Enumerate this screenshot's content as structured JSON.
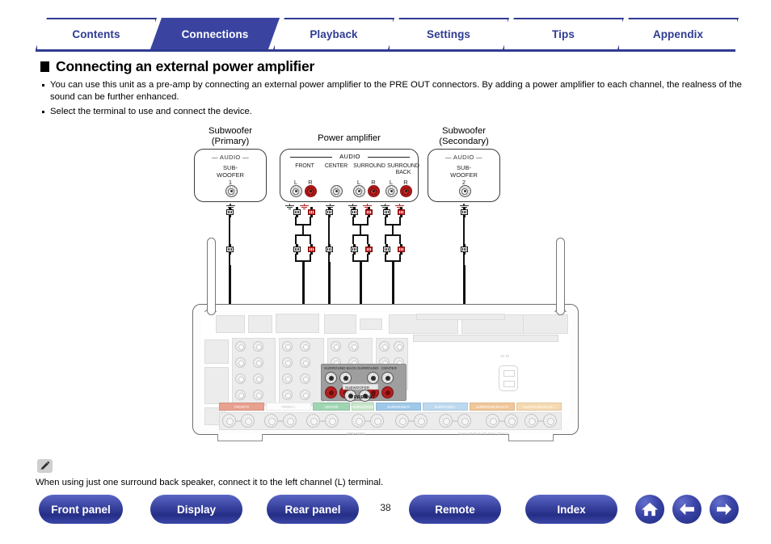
{
  "tabs": [
    {
      "label": "Contents",
      "active": false
    },
    {
      "label": "Connections",
      "active": true
    },
    {
      "label": "Playback",
      "active": false
    },
    {
      "label": "Settings",
      "active": false
    },
    {
      "label": "Tips",
      "active": false
    },
    {
      "label": "Appendix",
      "active": false
    }
  ],
  "heading": "Connecting an external power amplifier",
  "bullets": [
    "You can use this unit as a pre-amp by connecting an external power amplifier to the PRE OUT connectors. By adding a power amplifier to each channel, the realness of the sound can be further enhanced.",
    "Select the terminal to use and connect the device."
  ],
  "diagram": {
    "subwoofer_primary": {
      "title": "Subwoofer\n(Primary)",
      "audio": "— AUDIO —",
      "jack_label": "SUB-\nWOOFER\n1"
    },
    "subwoofer_secondary": {
      "title": "Subwoofer\n(Secondary)",
      "audio": "— AUDIO —",
      "jack_label": "SUB-\nWOOFER\n2"
    },
    "power_amplifier": {
      "title": "Power amplifier",
      "audio": "AUDIO",
      "channels": [
        {
          "name": "FRONT",
          "lr": [
            "L",
            "R"
          ]
        },
        {
          "name": "CENTER",
          "lr": []
        },
        {
          "name": "SURROUND",
          "lr": [
            "L",
            "R"
          ]
        },
        {
          "name": "SURROUND\nBACK",
          "lr": [
            "L",
            "R"
          ]
        }
      ]
    },
    "receiver": {
      "preout_caption": "PRE OUT",
      "preout_labels": [
        "SURROUND BACK",
        "SURROUND",
        "CENTER",
        "SUBWOOFER"
      ],
      "ac_label": "AC IN",
      "speaker_strips": [
        {
          "text": "FRONT R",
          "color": "#e8a08f"
        },
        {
          "text": "FRONT L",
          "color": "#ffffff"
        },
        {
          "text": "CENTER",
          "color": "#9ed6b2"
        },
        {
          "text": "SUBWOOFER",
          "color": "#c8e6c9"
        },
        {
          "text": "SURROUND R",
          "color": "#9fc8e8"
        },
        {
          "text": "SURROUND L",
          "color": "#bcd9ef"
        },
        {
          "text": "SURROUND BACK R",
          "color": "#f0c79a"
        },
        {
          "text": "SURROUND BACK L",
          "color": "#f5d9b0"
        }
      ],
      "bottom_labels": [
        "SPEAKERS",
        "Surround Back / Bi-Amp / Zone 2"
      ]
    }
  },
  "note": {
    "icon": "pencil-icon",
    "text": "When using just one surround back speaker, connect it to the left channel (L) terminal."
  },
  "footer": {
    "buttons": [
      "Front panel",
      "Display",
      "Rear panel",
      "Remote",
      "Index"
    ],
    "page_number": "38",
    "nav_icons": [
      "home-icon",
      "back-arrow-icon",
      "forward-arrow-icon"
    ]
  },
  "colors": {
    "brand_blue": "#3a44a0",
    "tab_border": "#2f3b92",
    "rca_red": "#c81e1e"
  }
}
